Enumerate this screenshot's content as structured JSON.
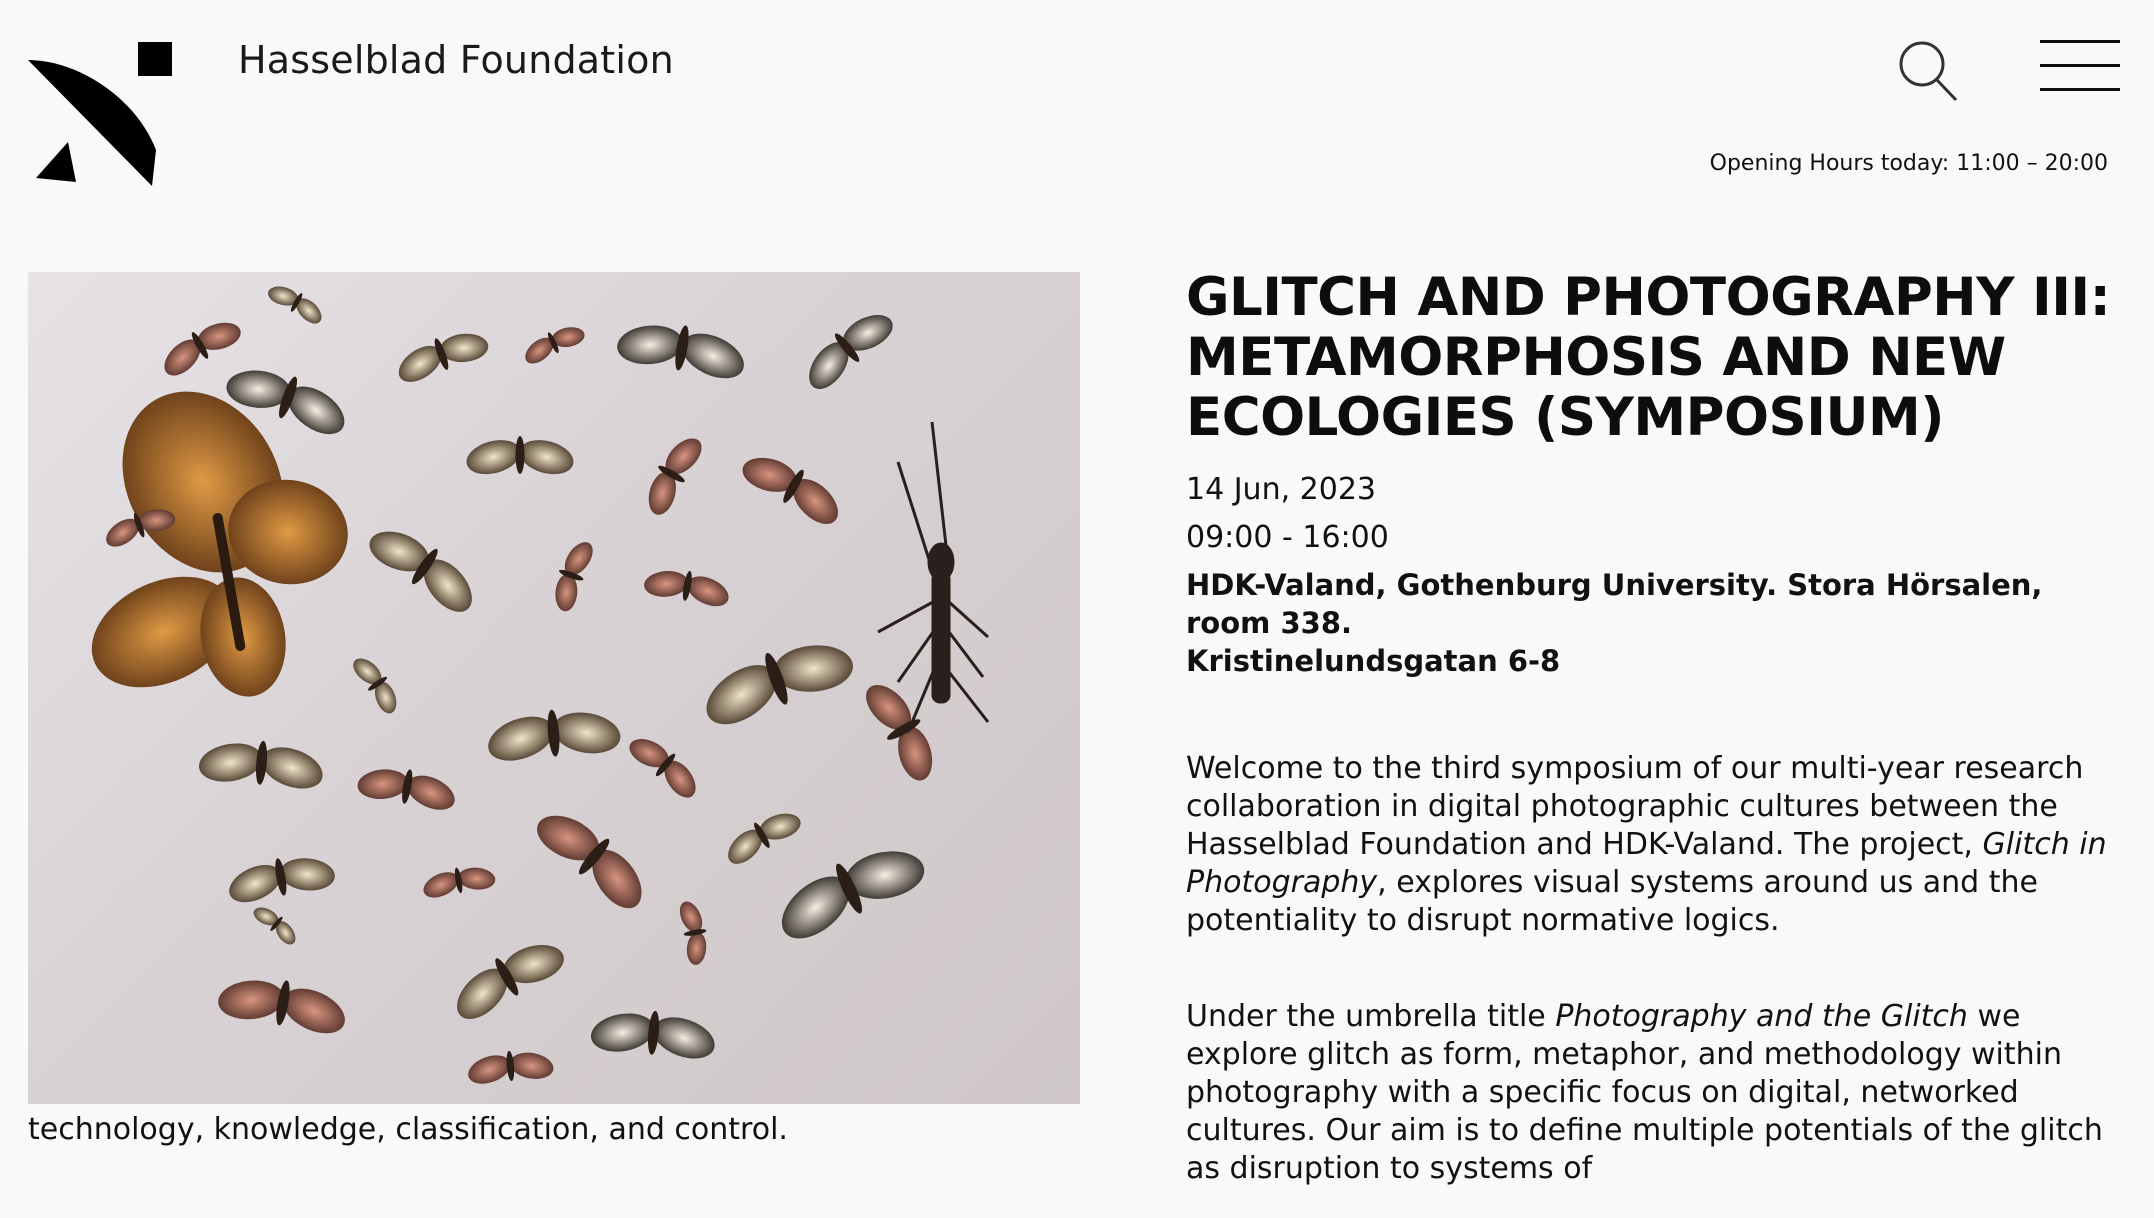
{
  "header": {
    "brand": "Hasselblad Foundation",
    "opening_hours": "Opening Hours today: 11:00 – 20:00"
  },
  "hero": {
    "alt": "Pinned butterflies and moths"
  },
  "event": {
    "title": "GLITCH AND PHOTOGRAPHY III: METAMORPHOSIS AND NEW ECOLOGIES (SYMPOSIUM)",
    "date": "14 Jun, 2023",
    "time": "09:00 - 16:00",
    "venue_line1": "HDK-Valand, Gothenburg University. Stora Hörsalen, room 338.",
    "venue_line2": "Kristinelundsgatan 6-8",
    "para1_part1": "Welcome to the third symposium of our multi-year research collaboration in digital photographic cultures between the Hasselblad Foundation and HDK-Valand. The project, ",
    "para1_em": "Glitch in Photography",
    "para1_part2": ", explores visual systems around us and the potentiality to disrupt normative logics.",
    "para2_part1": "Under the umbrella title ",
    "para2_em": "Photography and the Glitch",
    "para2_part2": " we explore glitch as form, metaphor, and methodology within photography with a specific focus on digital, networked cultures. Our aim is to define multiple potentials of the glitch as disruption to systems of",
    "continuation": "technology, knowledge, classification, and control."
  },
  "colors": {
    "background": "#f9f9fa",
    "text": "#111111",
    "monarch": "#c9782a"
  }
}
